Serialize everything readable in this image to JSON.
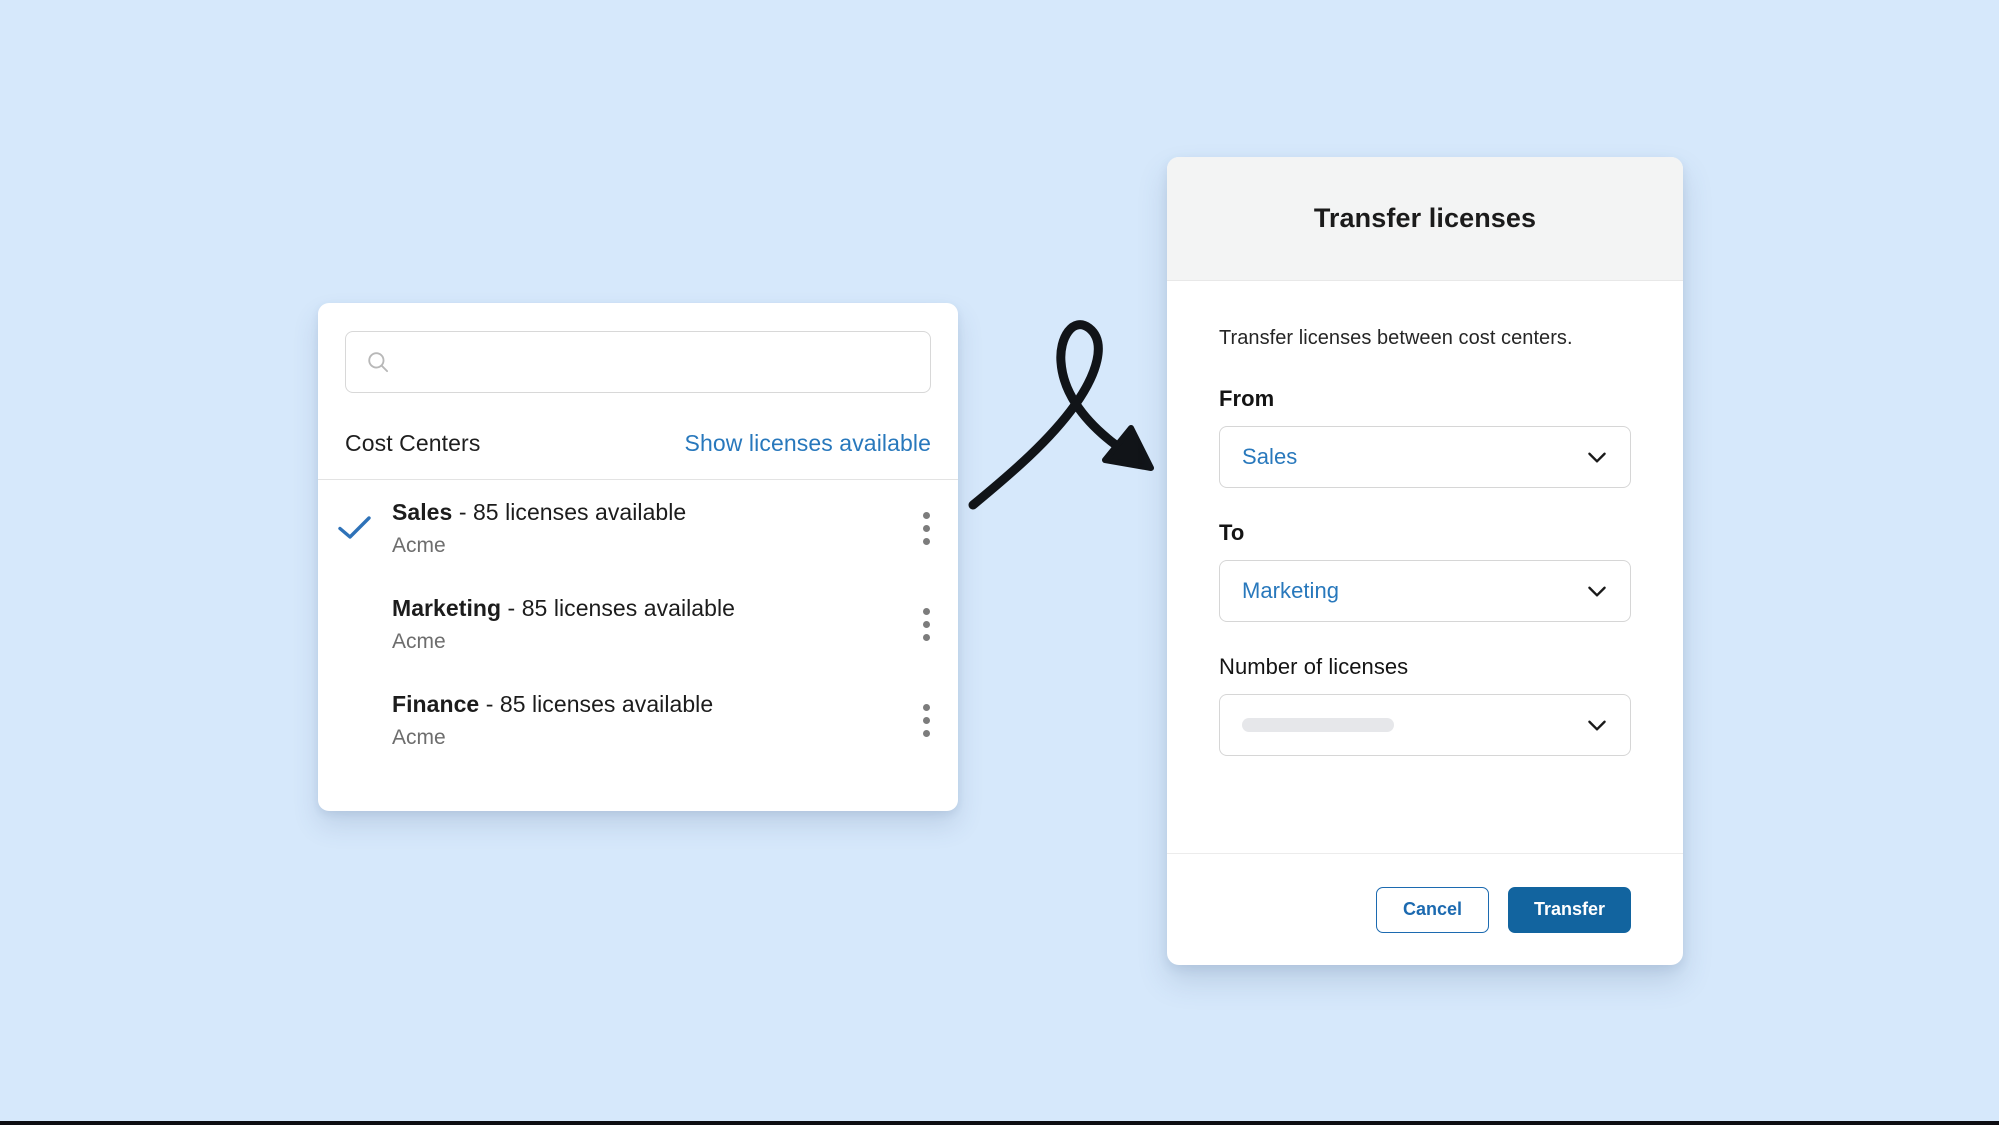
{
  "theme": {
    "background": "#d6e8fb",
    "accent_blue": "#2878bc",
    "primary_button": "#12649f",
    "card_white": "#ffffff",
    "header_gray": "#f3f4f4",
    "muted_text": "#6d6d6d"
  },
  "list_panel": {
    "search": {
      "value": "",
      "placeholder": "",
      "icon": "search-icon"
    },
    "header": {
      "title": "Cost Centers",
      "link": "Show licenses available"
    },
    "items": [
      {
        "name": "Sales",
        "detail": "- 85 licenses available",
        "subtitle": "Acme",
        "selected": true,
        "menu_icon": "kebab-menu-icon"
      },
      {
        "name": "Marketing",
        "detail": "- 85 licenses available",
        "subtitle": "Acme",
        "selected": false,
        "menu_icon": "kebab-menu-icon"
      },
      {
        "name": "Finance",
        "detail": "- 85 licenses available",
        "subtitle": "Acme",
        "selected": false,
        "menu_icon": "kebab-menu-icon"
      }
    ]
  },
  "annotation": {
    "arrow": "hand-drawn-looping-arrow"
  },
  "dialog": {
    "title": "Transfer licenses",
    "description": "Transfer licenses between cost centers.",
    "fields": {
      "from": {
        "label": "From",
        "value": "Sales",
        "chevron": "chevron-down-icon"
      },
      "to": {
        "label": "To",
        "value": "Marketing",
        "chevron": "chevron-down-icon"
      },
      "number": {
        "label": "Number of licenses",
        "value": "",
        "chevron": "chevron-down-icon"
      }
    },
    "buttons": {
      "cancel": "Cancel",
      "transfer": "Transfer"
    }
  }
}
